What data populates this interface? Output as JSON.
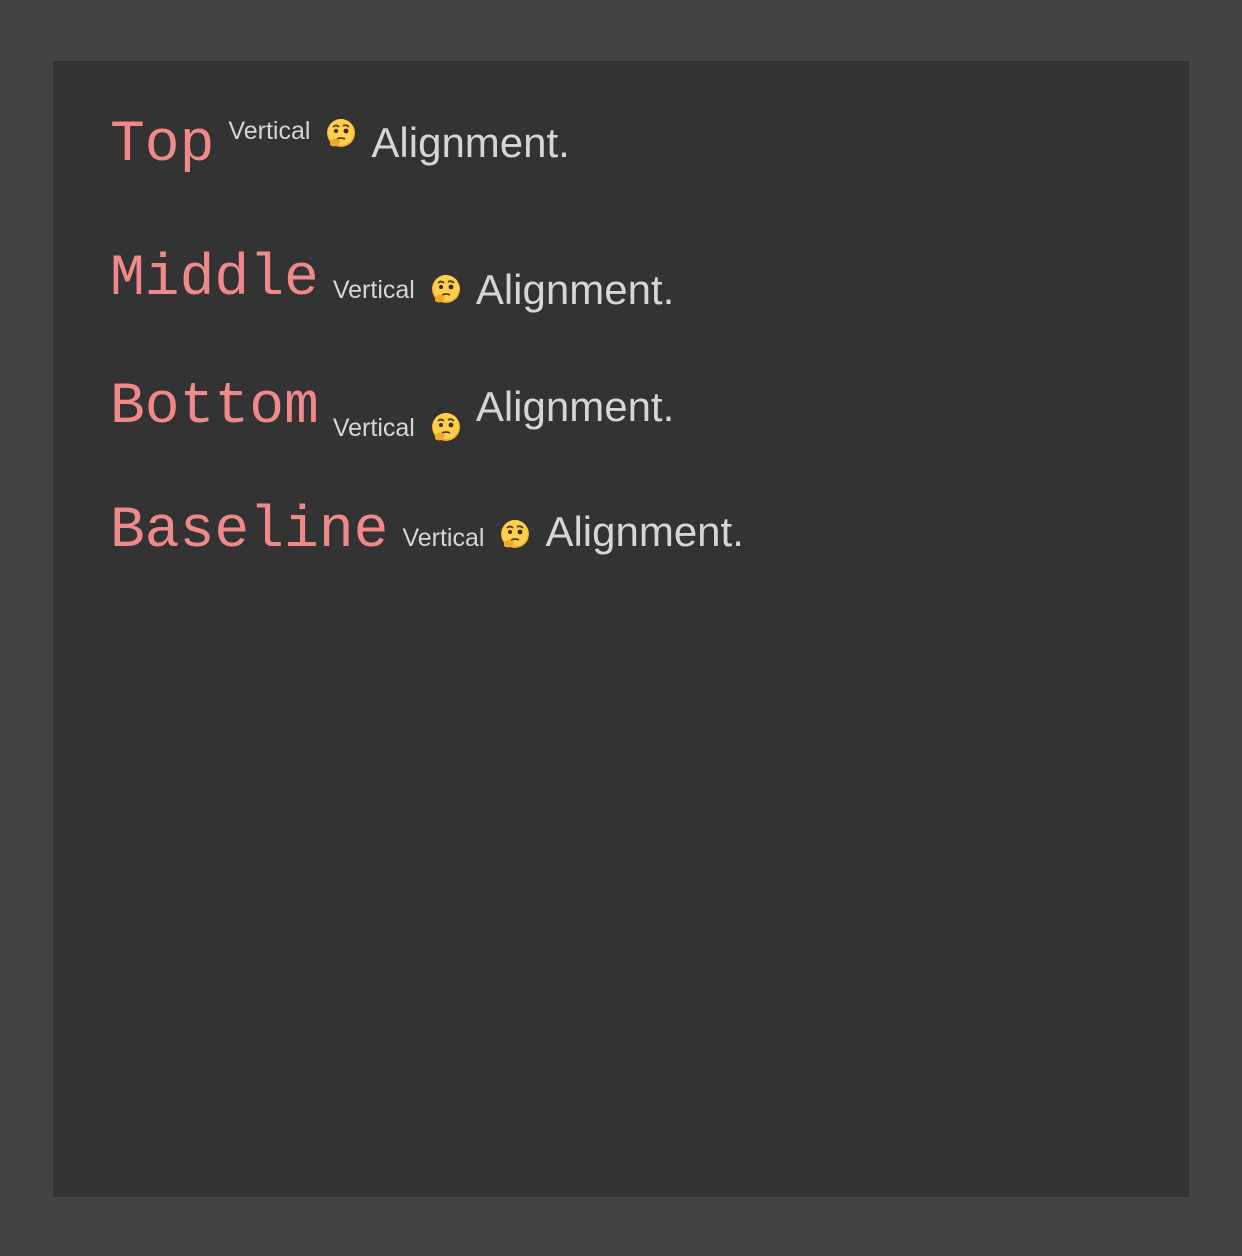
{
  "rows": [
    {
      "keyword": "Top",
      "small": "Vertical",
      "emoji": "thinking-face-icon",
      "big": "Alignment."
    },
    {
      "keyword": "Middle",
      "small": "Vertical",
      "emoji": "thinking-face-icon",
      "big": "Alignment."
    },
    {
      "keyword": "Bottom",
      "small": "Vertical",
      "emoji": "thinking-face-icon",
      "big": "Alignment."
    },
    {
      "keyword": "Baseline",
      "small": "Vertical",
      "emoji": "thinking-face-icon",
      "big": "Alignment."
    }
  ],
  "colors": {
    "outer_background": "#434343",
    "panel_background": "#333333",
    "keyword": "#F08A8A",
    "text": "#D6D6D6"
  }
}
